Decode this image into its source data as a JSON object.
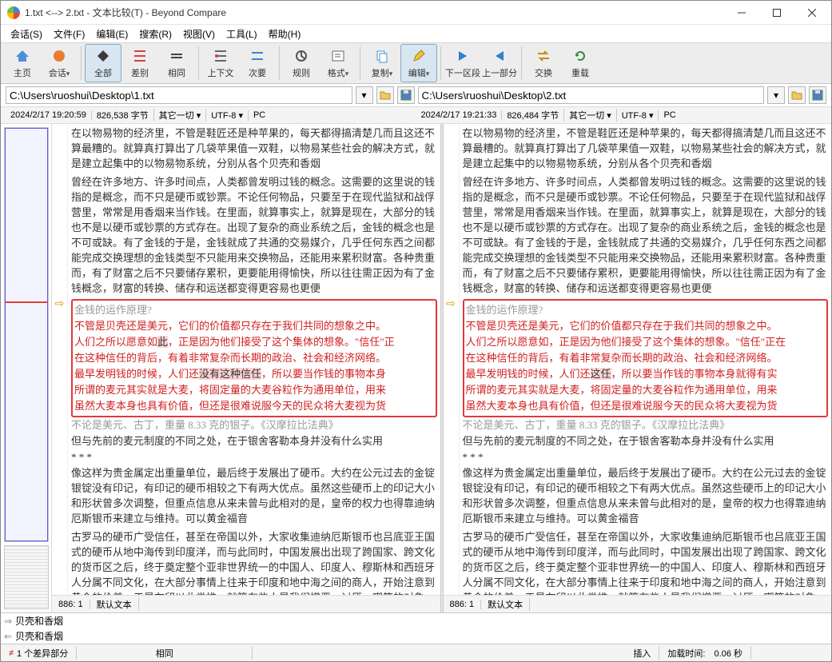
{
  "window": {
    "title": "1.txt <--> 2.txt - 文本比较(T) - Beyond Compare"
  },
  "menus": {
    "session": "会话(S)",
    "file": "文件(F)",
    "edit": "编辑(E)",
    "search": "搜索(R)",
    "view": "视图(V)",
    "tools": "工具(L)",
    "help": "帮助(H)"
  },
  "toolbar": {
    "home": "主页",
    "session": "会话",
    "all": "全部",
    "diff": "差别",
    "same": "相同",
    "context": "上下文",
    "minor": "次要",
    "rules": "规则",
    "format": "格式",
    "copy": "复制",
    "edit": "编辑",
    "next": "下一区段",
    "prev": "上一部分",
    "swap": "交换",
    "reload": "重载"
  },
  "path": {
    "left": "C:\\Users\\ruoshui\\Desktop\\1.txt",
    "right": "C:\\Users\\ruoshui\\Desktop\\2.txt"
  },
  "info": {
    "left_date": "2024/2/17 19:20:59",
    "left_size": "826,538 字节",
    "left_other": "其它一切 ▾",
    "left_enc": "UTF-8 ▾",
    "left_pc": "PC",
    "right_date": "2024/2/17 19:21:33",
    "right_size": "826,484 字节",
    "right_other": "其它一切 ▾",
    "right_enc": "UTF-8 ▾",
    "right_pc": "PC"
  },
  "left_text": {
    "p1": "在以物易物的经济里，不管是鞋匠还是种苹果的，每天都得搞清楚几而且这还不算最糟的。就算真打算出了几袋苹果值一双鞋，以物易某些社会的解决方式，就是建立起集中的以物易物系统，分别从各个贝壳和香烟",
    "p2": "曾经在许多地方、许多时间点，人类都曾发明过钱的概念。这需要的这里说的钱指的是概念，而不只是硬币或钞票。不论任何物品，只要至于在现代监狱和战俘营里，常常是用香烟来当作钱。在里面，就算事实上，就算是现在，大部分的钱也不是以硬币或钞票的方式存在。出现了复杂的商业系统之后，金钱的概念也是不可或缺。有了金钱的于是，金钱就成了共通的交易媒介，几乎任何东西之间都能完成交换理想的金钱类型不只能用来交换物品，还能用来累积财富。各种贵重而，有了财富之后不只要储存累积，更要能用得愉快，所以往往需正因为有了金钱概念，财富的转换、储存和运送都变得更容易也更便",
    "dh": "金钱的运作原理?",
    "d1a": "不管是贝壳还是美元，它们的价值都只存在于我们共同的想象之中。",
    "d2a": "人们之所以愿意如",
    "d2b": "此",
    "d2c": "，正是因为他们接受了这个集体的想象。\"信任\"正",
    "d3": "在这种信任的背后，有着非常复杂而长期的政治、社会和经济网络。",
    "d4a": "最早发明钱的时候，人们还",
    "d4b": "没有这种信任",
    "d4c": "，所以要当作钱的事物本身",
    "d5": "所谓的麦元其实就是大麦，将固定量的大麦谷粒作为通用单位，用来",
    "d6": "虽然大麦本身也具有价值，但还是很难说服今天的民众将大麦视为货",
    "aft_a": "不论是美元、古丁，重量 8.33 克的银子。《汉摩拉比法典》",
    "aft_b": "但与先前的麦元制度的不同之处，在于银舍客勒本身并没有什么实用",
    "aft_c": "* * *",
    "p3": "像这样为贵金属定出重量单位，最后终于发展出了硬币。大约在公元过去的金锭银锭没有印记，有印记的硬币相较之下有两大优点。虽然这些硬币上的印记大小和形状曾多次调整，但重点信息从来未曾与此相对的是，皇帝的权力也得靠迪纳厄斯银币来建立与维持。可以黄金福音",
    "p4": "古罗马的硬币广受信任，甚至在帝国以外，大家收集迪纳厄斯银币也吕底亚王国式的硬币从地中海传到印度洋，而与此同时，中国发展出出现了跨国家、跨文化的货币区之后，终于奠定整个亚非世界统一的中国人、印度人、穆斯林和西班牙人分属不同文化，在大部分事情上往来于印度和地中海之间的商人，开始注意到黄金的价差，于是在印以此类推，就算有些人是我们憎恶、讨厌、嘲笑的对象，如果他们相千百年来，哲学家、思想家和宗教人物都对钱嗤之以鼻，称钱为万恶"
  },
  "right_text": {
    "p1": "在以物易物的经济里，不管是鞋匠还是种苹果的，每天都得搞清楚几而且这还不算最糟的。就算真打算出了几袋苹果值一双鞋，以物易某些社会的解决方式，就是建立起集中的以物易物系统，分别从各个贝壳和香烟",
    "p2": "曾经在许多地方、许多时间点，人类都曾发明过钱的概念。这需要的这里说的钱指的是概念，而不只是硬币或钞票。不论任何物品，只要至于在现代监狱和战俘营里，常常是用香烟来当作钱。在里面，就算事实上，就算是现在，大部分的钱也不是以硬币或钞票的方式存在。出现了复杂的商业系统之后，金钱的概念也是不可或缺。有了金钱的于是，金钱就成了共通的交易媒介，几乎任何东西之间都能完成交换理想的金钱类型不只能用来交换物品，还能用来累积财富。各种贵重而，有了财富之后不只要储存累积，更要能用得愉快，所以往往需正因为有了金钱概念，财富的转换、储存和运送都变得更容易也更便",
    "dh": "金钱的运作原理?",
    "d1a": "不管是贝壳还是美元，它们的价值都只存在于我们共同的想象之中。",
    "d2a": "人们之所以愿意如，正是因为他们接受了这个集体的想象。\"信任\"正在",
    "d3": "在这种信任的背后，有着非常复杂而长期的政治、社会和经济网络。",
    "d4a": "最早发明钱的时候，人们还",
    "d4b": "这任",
    "d4c": "，所以要当作钱的事物本身就得有实",
    "d5": "所谓的麦元其实就是大麦，将固定量的大麦谷粒作为通用单位，用来",
    "d6": "虽然大麦本身也具有价值，但还是很难说服今天的民众将大麦视为货",
    "aft_a": "不论是美元、古丁，重量 8.33 克的银子。《汉摩拉比法典》",
    "aft_b": "但与先前的麦元制度的不同之处，在于银舍客勒本身并没有什么实用",
    "aft_c": "* * *",
    "p3": "像这样为贵金属定出重量单位，最后终于发展出了硬币。大约在公元过去的金锭银锭没有印记，有印记的硬币相较之下有两大优点。虽然这些硬币上的印记大小和形状曾多次调整，但重点信息从来未曾与此相对的是，皇帝的权力也得靠迪纳厄斯银币来建立与维持。可以黄金福音",
    "p4": "古罗马的硬币广受信任，甚至在帝国以外，大家收集迪纳厄斯银币也吕底亚王国式的硬币从地中海传到印度洋，而与此同时，中国发展出出现了跨国家、跨文化的货币区之后，终于奠定整个亚非世界统一的中国人、印度人、穆斯林和西班牙人分属不同文化，在大部分事情上往来于印度和地中海之间的商人，开始注意到黄金的价差，于是在印以此类推，就算有些人是我们憎恶、讨厌、嘲笑的对象，如果他们相千百年来，哲学家、思想家和宗教人物都对钱嗤之以鼻，称钱为万恶"
  },
  "colfoot": {
    "left_pos": "886: 1",
    "left_mode": "默认文本",
    "right_pos": "886: 1",
    "right_mode": "默认文本"
  },
  "bottom": {
    "line1": "贝壳和香烟",
    "line2": "贝壳和香烟"
  },
  "status": {
    "diff": "1 个差异部分",
    "same": "相同",
    "insert": "插入",
    "load": "加载时间:",
    "time": "0.06 秒"
  }
}
